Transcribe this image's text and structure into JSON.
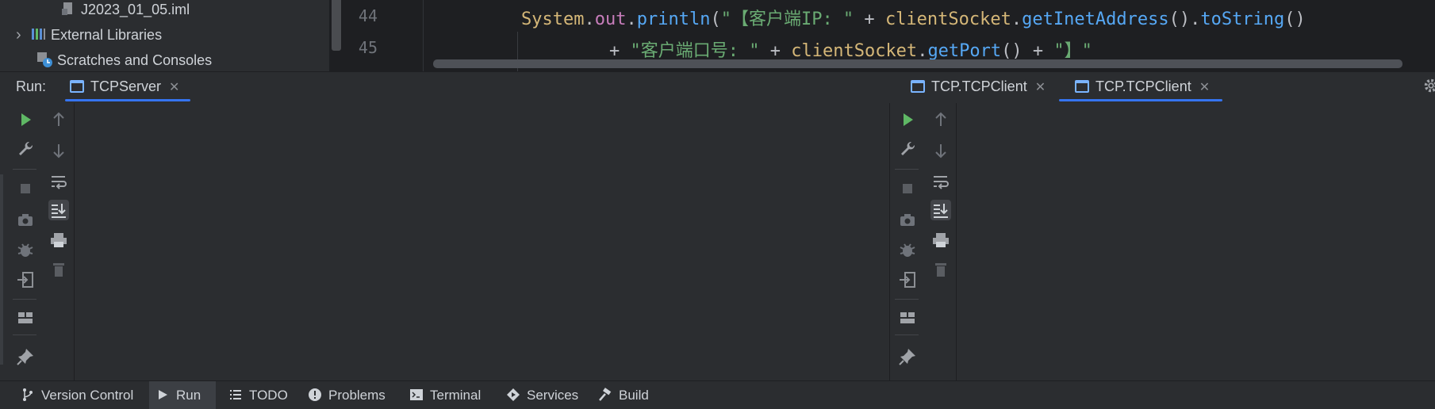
{
  "project_tree": {
    "items": [
      {
        "label": "J2023_01_05.iml",
        "icon": "iml-file-icon"
      },
      {
        "label": "External Libraries",
        "icon": "libraries-icon",
        "expander": "›"
      },
      {
        "label": "Scratches and Consoles",
        "icon": "scratches-icon"
      }
    ]
  },
  "editor": {
    "line_numbers": [
      "44",
      "45"
    ],
    "line1": {
      "t1": "System",
      "t2": ".",
      "t3": "out",
      "t4": ".",
      "t5": "println",
      "t6": "(",
      "t7": "\"【客户端IP: \"",
      "t8": " + ",
      "t9": "clientSocket",
      "t10": ".",
      "t11": "getInetAddress",
      "t12": "().",
      "t13": "toString",
      "t14": "()"
    },
    "line2": {
      "t1": "+ ",
      "t2": "\"客户端口号: \"",
      "t3": " + ",
      "t4": "clientSocket",
      "t5": ".",
      "t6": "getPort",
      "t7": "() + ",
      "t8": "\"】\""
    }
  },
  "run": {
    "label": "Run:",
    "tabs": [
      {
        "label": "TCPServer",
        "close": "✕",
        "active": true
      },
      {
        "label": "TCP.TCPClient",
        "close": "✕",
        "active": false
      },
      {
        "label": "TCP.TCPClient",
        "close": "✕",
        "active": true
      }
    ]
  },
  "toolbar_icons": [
    "rerun-icon",
    "settings-wrench-icon",
    "stop-icon",
    "camera-icon",
    "debug-bug-icon",
    "exit-icon",
    "layout-icon",
    "pin-icon",
    "up-arrow-icon",
    "down-arrow-icon",
    "soft-wrap-icon",
    "scroll-to-end-icon",
    "print-icon",
    "trash-icon"
  ],
  "bottom_bar": {
    "items": [
      {
        "label": "Version Control",
        "icon": "vcs-icon"
      },
      {
        "label": "Run",
        "icon": "run-icon",
        "active": true
      },
      {
        "label": "TODO",
        "icon": "todo-icon"
      },
      {
        "label": "Problems",
        "icon": "problems-icon"
      },
      {
        "label": "Terminal",
        "icon": "terminal-icon"
      },
      {
        "label": "Services",
        "icon": "services-icon"
      },
      {
        "label": "Build",
        "icon": "build-hammer-icon"
      }
    ]
  },
  "colors": {
    "accent": "#3574f0",
    "run_green": "#5fb865",
    "editor_bg": "#1e1f22",
    "panel_bg": "#2b2d30"
  }
}
